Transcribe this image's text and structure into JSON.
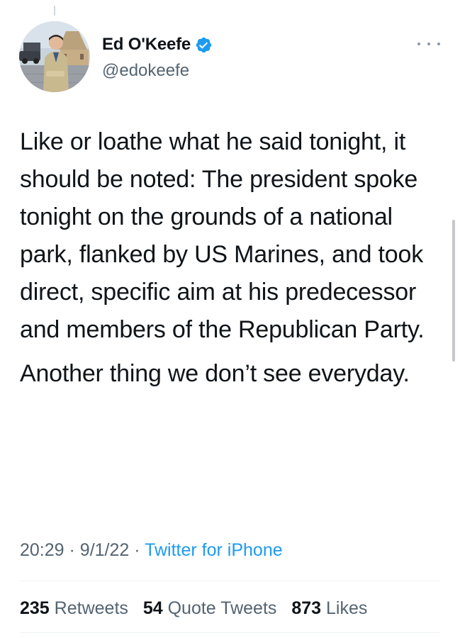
{
  "author": {
    "display_name": "Ed O'Keefe",
    "handle": "@edokeefe",
    "verified": true
  },
  "tweet": {
    "paragraphs": [
      "Like or loathe what he said tonight, it should be noted: The president spoke tonight on the grounds of a national park, flanked by US Marines, and took direct, specific aim at his predecessor and members of the Republican Party.",
      "Another thing we don’t see everyday."
    ],
    "time": "20:29",
    "date": "9/1/22",
    "separator": "·",
    "source": "Twitter for iPhone"
  },
  "stats": {
    "retweets_count": "235",
    "retweets_label": "Retweets",
    "quotes_count": "54",
    "quotes_label": "Quote Tweets",
    "likes_count": "873",
    "likes_label": "Likes"
  },
  "icons": {
    "verified": "verified-badge-icon",
    "more": "more-horizontal-icon"
  },
  "colors": {
    "accent": "#1d9bf0",
    "secondary_text": "#536471",
    "primary_text": "#0f1419"
  }
}
